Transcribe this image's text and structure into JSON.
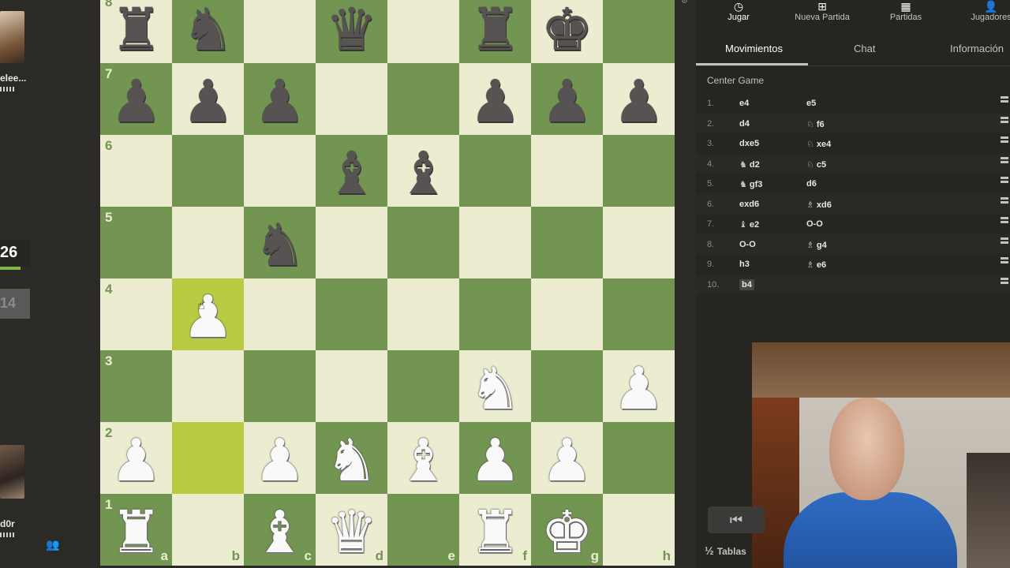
{
  "left": {
    "top_player": "elee...",
    "bottom_player": "d0r",
    "top_clock_partial": "26",
    "bottom_clock_partial": "14"
  },
  "board": {
    "ranks": [
      "8",
      "7",
      "6",
      "5",
      "4",
      "3",
      "2",
      "1"
    ],
    "files": [
      "a",
      "b",
      "c",
      "d",
      "e",
      "f",
      "g",
      "h"
    ],
    "squares": [
      [
        "br",
        "bn",
        "",
        "bq",
        "",
        "br",
        "bk",
        ""
      ],
      [
        "bp",
        "bp",
        "bp",
        "",
        "",
        "bp",
        "bp",
        "bp"
      ],
      [
        "",
        "",
        "",
        "bb",
        "bb",
        "",
        "",
        ""
      ],
      [
        "",
        "",
        "bn",
        "",
        "",
        "",
        "",
        ""
      ],
      [
        "",
        "wp",
        "",
        "",
        "",
        "",
        "",
        ""
      ],
      [
        "",
        "",
        "",
        "",
        "",
        "wn",
        "",
        "wp"
      ],
      [
        "wp",
        "",
        "wp",
        "wn",
        "wb",
        "wp",
        "wp",
        ""
      ],
      [
        "wr",
        "",
        "wb",
        "wq",
        "",
        "wr",
        "wk",
        ""
      ]
    ],
    "highlights": [
      "b4",
      "b2"
    ]
  },
  "topnav": {
    "items": [
      {
        "label": "Jugar",
        "icon": "clock-icon"
      },
      {
        "label": "Nueva Partida",
        "icon": "plus-icon"
      },
      {
        "label": "Partidas",
        "icon": "board-icon"
      },
      {
        "label": "Jugadores",
        "icon": "people-icon"
      }
    ]
  },
  "tabs": [
    "Movimientos",
    "Chat",
    "Información"
  ],
  "opening": "Center Game",
  "moves": [
    {
      "n": "1.",
      "w": "e4",
      "wf": "",
      "b": "e5",
      "bf": ""
    },
    {
      "n": "2.",
      "w": "d4",
      "wf": "",
      "b": "f6",
      "bf": "♘"
    },
    {
      "n": "3.",
      "w": "dxe5",
      "wf": "",
      "b": "xe4",
      "bf": "♘"
    },
    {
      "n": "4.",
      "w": "d2",
      "wf": "♞",
      "b": "c5",
      "bf": "♘"
    },
    {
      "n": "5.",
      "w": "gf3",
      "wf": "♞",
      "b": "d6",
      "bf": ""
    },
    {
      "n": "6.",
      "w": "exd6",
      "wf": "",
      "b": "xd6",
      "bf": "♗"
    },
    {
      "n": "7.",
      "w": "e2",
      "wf": "♝",
      "b": "O-O",
      "bf": ""
    },
    {
      "n": "8.",
      "w": "O-O",
      "wf": "",
      "b": "g4",
      "bf": "♗"
    },
    {
      "n": "9.",
      "w": "h3",
      "wf": "",
      "b": "e6",
      "bf": "♗"
    },
    {
      "n": "10.",
      "w": "b4",
      "wf": "",
      "b": "",
      "bf": ""
    }
  ],
  "controls": {
    "first_move": "⏮",
    "draw_label": "Tablas",
    "draw_symbol": "½"
  }
}
